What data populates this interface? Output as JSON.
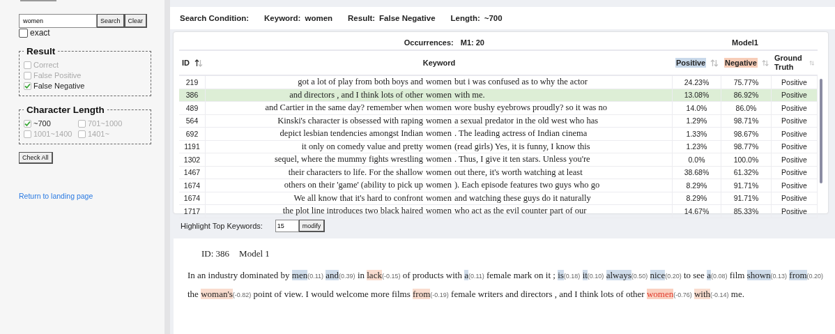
{
  "sidebar": {
    "search": {
      "value": "women",
      "buttons": [
        "Search",
        "Clear"
      ]
    },
    "exact": {
      "label": "exact",
      "checked": false
    },
    "result": {
      "title": "Result",
      "options": [
        {
          "label": "Correct",
          "checked": false
        },
        {
          "label": "False Positive",
          "checked": false
        },
        {
          "label": "False Negative",
          "checked": true
        }
      ]
    },
    "length": {
      "title": "Character Length",
      "options": [
        {
          "label": "~700",
          "checked": true
        },
        {
          "label": "701~1000",
          "checked": false
        },
        {
          "label": "1001~1400",
          "checked": false
        },
        {
          "label": "1401~",
          "checked": false
        }
      ]
    },
    "check_all": "Check All",
    "link": "Return to landing page"
  },
  "condition": {
    "title": "Search Condition:",
    "items": [
      {
        "label": "Keyword:",
        "value": "women"
      },
      {
        "label": "Result:",
        "value": "False Negative"
      },
      {
        "label": "Length:",
        "value": "~700"
      }
    ]
  },
  "table": {
    "occurrences": {
      "label": "Occurrences:",
      "value": "M1: 20"
    },
    "model": "Model1",
    "columns": [
      {
        "label": "ID",
        "kind": "sortable",
        "sorted": true
      },
      {
        "label": "Keyword",
        "kind": "plain"
      },
      {
        "label": "Positive",
        "kind": "sortable",
        "sorted": false,
        "color": "#c9d9ea"
      },
      {
        "label": "Negative",
        "kind": "sortable",
        "sorted": false,
        "color": "#f7cdb8"
      },
      {
        "label": "Ground Truth",
        "kind": "sortable",
        "sorted": false
      }
    ],
    "rows": [
      {
        "id": "219",
        "left": "got a lot of play from both boys and",
        "keyword": "women",
        "right": "but i was confused as to why the actor",
        "positive": "24.23%",
        "negative": "75.77%",
        "truth": "Positive",
        "selected": false
      },
      {
        "id": "386",
        "left": "and directors , and I think lots of other",
        "keyword": "women",
        "right": "with me.",
        "positive": "13.08%",
        "negative": "86.92%",
        "truth": "Positive",
        "selected": true
      },
      {
        "id": "489",
        "left": "and Cartier in the same day? remember when",
        "keyword": "women",
        "right": "wore bushy eyebrows proudly? so it was no",
        "positive": "14.0%",
        "negative": "86.0%",
        "truth": "Positive",
        "selected": false
      },
      {
        "id": "564",
        "left": "Kinski's character is obsessed with raping",
        "keyword": "women",
        "right": "a sexual predator in the old west who has",
        "positive": "1.29%",
        "negative": "98.71%",
        "truth": "Positive",
        "selected": false
      },
      {
        "id": "692",
        "left": "depict lesbian tendencies amongst Indian",
        "keyword": "women",
        "right": ". The leading actress of Indian cinema",
        "positive": "1.33%",
        "negative": "98.67%",
        "truth": "Positive",
        "selected": false
      },
      {
        "id": "1191",
        "left": "it only on comedy value and pretty",
        "keyword": "women",
        "right": "(read girls) Yes, it is funny, I know this",
        "positive": "1.23%",
        "negative": "98.77%",
        "truth": "Positive",
        "selected": false
      },
      {
        "id": "1302",
        "left": "sequel, where the mummy fights wrestling",
        "keyword": "women",
        "right": ". Thus, I give it ten stars. Unless you're",
        "positive": "0.0%",
        "negative": "100.0%",
        "truth": "Positive",
        "selected": false
      },
      {
        "id": "1467",
        "left": "their characters to life. For the shallow",
        "keyword": "women",
        "right": "out there, it's worth watching at least",
        "positive": "38.68%",
        "negative": "61.32%",
        "truth": "Positive",
        "selected": false
      },
      {
        "id": "1674",
        "left": "others on their 'game' (ability to pick up",
        "keyword": "women",
        "right": "). Each episode features two guys who go",
        "positive": "8.29%",
        "negative": "91.71%",
        "truth": "Positive",
        "selected": false
      },
      {
        "id": "1674",
        "left": "We all know that it's hard to confront",
        "keyword": "women",
        "right": "and watching these guys do it naturally",
        "positive": "8.29%",
        "negative": "91.71%",
        "truth": "Positive",
        "selected": false
      },
      {
        "id": "1717",
        "left": "the plot line introduces two black haired",
        "keyword": "women",
        "right": "who act as the evil counter part of our",
        "positive": "14.67%",
        "negative": "85.33%",
        "truth": "Positive",
        "selected": false
      }
    ]
  },
  "highlight": {
    "label": "Highlight Top Keywords:",
    "value": "15",
    "button": "modify"
  },
  "detail": {
    "id": "ID: 386",
    "model": "Model 1",
    "segments": [
      {
        "text": "In an industry dominated by"
      },
      {
        "text": "men",
        "score": "(0.11)",
        "kind": "positive"
      },
      {
        "text": "and",
        "score": "(0.39)",
        "kind": "positive"
      },
      {
        "text": "in"
      },
      {
        "text": "lack",
        "score": "(-0.15)",
        "kind": "negative"
      },
      {
        "text": "of products with"
      },
      {
        "text": "a",
        "score": "(0.11)",
        "kind": "positive"
      },
      {
        "text": "female mark on it ;"
      },
      {
        "text": "is",
        "score": "(0.18)",
        "kind": "positive"
      },
      {
        "text": "it",
        "score": "(0.10)",
        "kind": "positive"
      },
      {
        "text": "always",
        "score": "(0.50)",
        "kind": "positive"
      },
      {
        "text": "nice",
        "score": "(0.20)",
        "kind": "positive"
      },
      {
        "text": "to see"
      },
      {
        "text": "a",
        "score": "(0.08)",
        "kind": "positive"
      },
      {
        "text": "film"
      },
      {
        "text": "shown",
        "score": "(0.13)",
        "kind": "positive"
      },
      {
        "text": "from",
        "score": "(0.20)",
        "kind": "positive"
      },
      {
        "text": "the"
      },
      {
        "text": "woman's",
        "score": "(-0.82)",
        "kind": "negative"
      },
      {
        "text": "point of view. I would welcome more films"
      },
      {
        "text": "from",
        "score": "(-0.19)",
        "kind": "negative"
      },
      {
        "text": "female writers and directors , and I think lots of other"
      },
      {
        "text": "women",
        "score": "(-0.76)",
        "kind": "keyword"
      },
      {
        "text": "with",
        "score": "(-0.14)",
        "kind": "negative"
      },
      {
        "text": "me."
      }
    ]
  }
}
